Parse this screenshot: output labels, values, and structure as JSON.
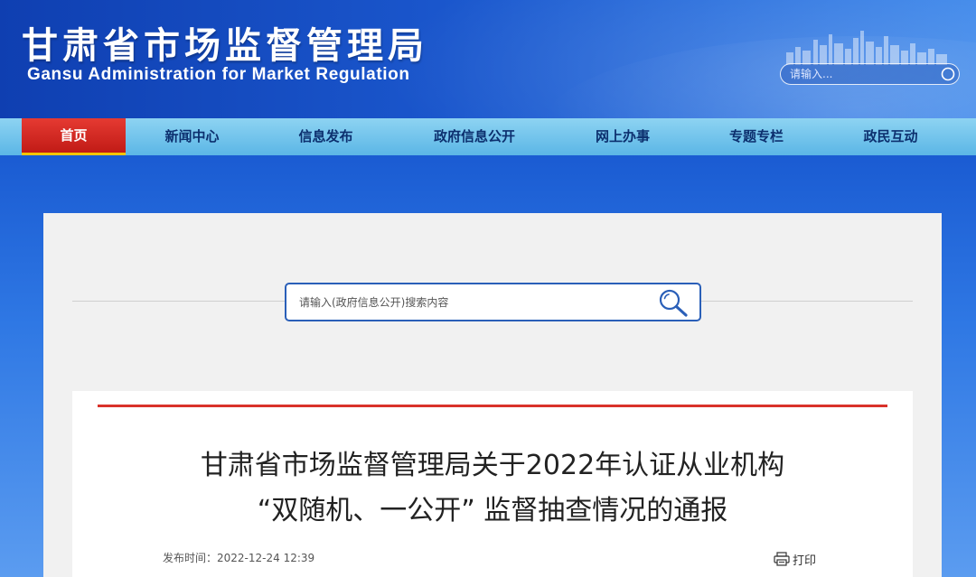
{
  "header": {
    "title_cn": "甘肃省市场监督管理局",
    "title_en": "Gansu Administration for Market Regulation",
    "search_placeholder": "请输入..."
  },
  "nav": {
    "items": [
      {
        "label": "首页",
        "active": true
      },
      {
        "label": "新闻中心"
      },
      {
        "label": "信息发布"
      },
      {
        "label": "政府信息公开"
      },
      {
        "label": "网上办事"
      },
      {
        "label": "专题专栏"
      },
      {
        "label": "政民互动"
      }
    ]
  },
  "info_search": {
    "placeholder": "请输入(政府信息公开)搜索内容"
  },
  "article": {
    "title_line1": "甘肃省市场监督管理局关于2022年认证从业机构",
    "title_line2": "“双随机、一公开” 监督抽查情况的通报",
    "publish_label": "发布时间：",
    "publish_time": "2022-12-24 12:39",
    "print_label": "打印"
  },
  "colors": {
    "header_blue": "#1a56cc",
    "nav_light_blue": "#5bb6e6",
    "active_red": "#c11b16",
    "accent_yellow": "#f5c400",
    "article_top_border": "#d9322a",
    "search_border": "#2a5fb8"
  }
}
